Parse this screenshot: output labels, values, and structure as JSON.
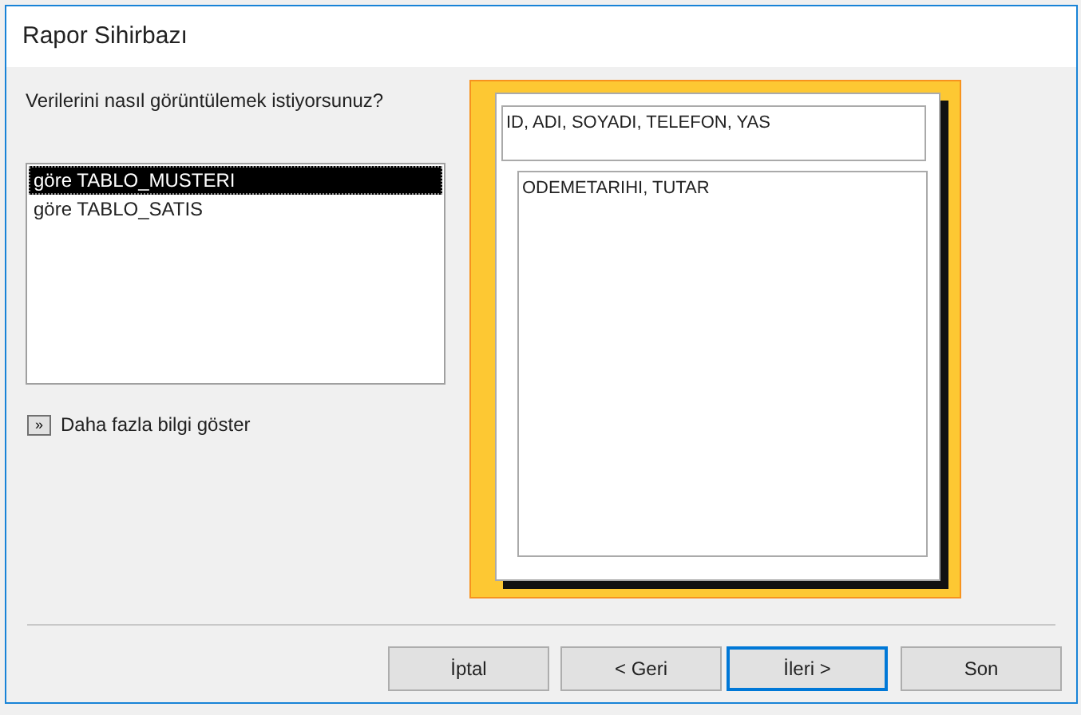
{
  "window": {
    "title": "Rapor Sihirbazı"
  },
  "question": "Verilerini nasıl görüntülemek istiyorsunuz?",
  "views": [
    {
      "label": "göre TABLO_MUSTERI",
      "selected": true
    },
    {
      "label": "göre TABLO_SATIS",
      "selected": false
    }
  ],
  "more_info": {
    "icon": "»",
    "label": "Daha fazla bilgi göster"
  },
  "preview": {
    "header_fields": "ID, ADI, SOYADI, TELEFON, YAS",
    "detail_fields": "ODEMETARIHI, TUTAR"
  },
  "buttons": [
    {
      "label": "İptal",
      "focused": false
    },
    {
      "label": "< Geri",
      "focused": false
    },
    {
      "label": "İleri >",
      "focused": true
    },
    {
      "label": "Son",
      "focused": false
    }
  ]
}
